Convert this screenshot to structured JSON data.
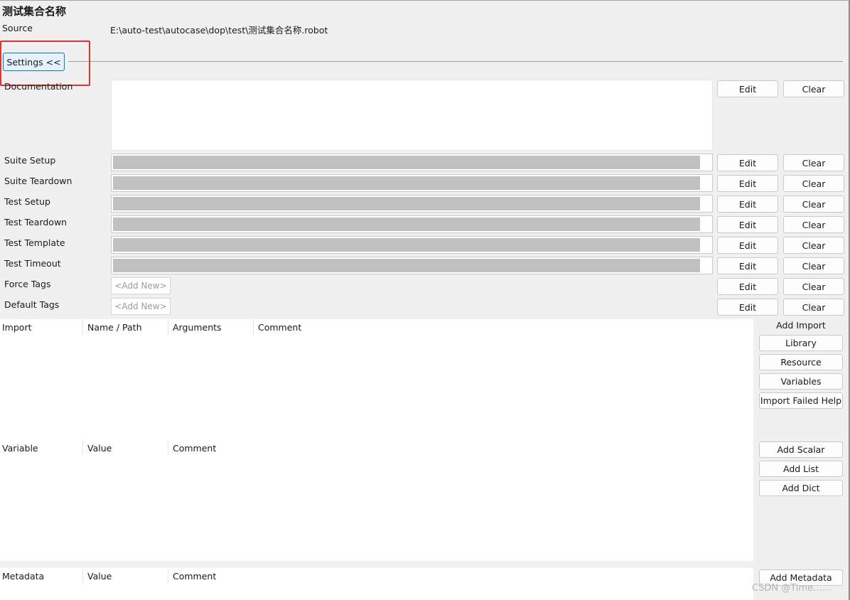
{
  "suite": {
    "title": "测试集合名称",
    "source_label": "Source",
    "source_path": "E:\\auto-test\\autocase\\dop\\test\\测试集合名称.robot"
  },
  "settings": {
    "toggle_label": "Settings <<",
    "documentation_label": "Documentation",
    "documentation_value": "",
    "edit_label": "Edit",
    "clear_label": "Clear",
    "add_new_placeholder": "<Add New>",
    "rows": [
      {
        "label": "Suite Setup",
        "value": ""
      },
      {
        "label": "Suite Teardown",
        "value": ""
      },
      {
        "label": "Test Setup",
        "value": ""
      },
      {
        "label": "Test Teardown",
        "value": ""
      },
      {
        "label": "Test Template",
        "value": ""
      },
      {
        "label": "Test Timeout",
        "value": ""
      }
    ],
    "tag_rows": [
      {
        "label": "Force Tags"
      },
      {
        "label": "Default Tags"
      }
    ]
  },
  "imports": {
    "columns": [
      "Import",
      "Name / Path",
      "Arguments",
      "Comment"
    ],
    "rows": [],
    "panel_title": "Add Import",
    "buttons": [
      "Library",
      "Resource",
      "Variables",
      "Import Failed Help"
    ]
  },
  "variables": {
    "columns": [
      "Variable",
      "Value",
      "Comment"
    ],
    "rows": [],
    "buttons": [
      "Add Scalar",
      "Add List",
      "Add Dict"
    ]
  },
  "metadata": {
    "columns": [
      "Metadata",
      "Value",
      "Comment"
    ],
    "rows": [],
    "buttons": [
      "Add Metadata"
    ]
  },
  "watermark": "CSDN @Time……",
  "colors": {
    "background": "#f0f0f0",
    "highlight_box": "#e8302c",
    "toggle_accent": "#0078d7",
    "field_fill": "#c0c0c0"
  }
}
